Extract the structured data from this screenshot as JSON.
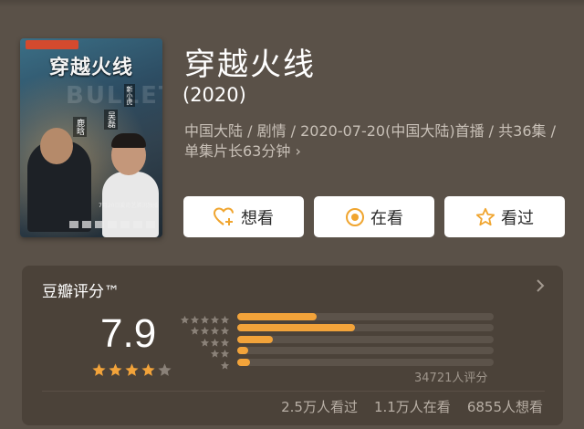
{
  "movie": {
    "title": "穿越火线",
    "year": "(2020)",
    "meta": "中国大陆 / 剧情 / 2020-07-20(中国大陆)首播 / 共36集 / 单集片长63分钟",
    "meta_chevron": "›"
  },
  "poster": {
    "title": "穿越火线",
    "tags": [
      "鹿晗",
      "吴磊",
      "新小虎"
    ],
    "date_text": "7月20日爱奇艺腾讯独播"
  },
  "actions": [
    {
      "label": "想看",
      "icon": "heart-plus-icon",
      "color": "#f0a52f"
    },
    {
      "label": "在看",
      "icon": "target-icon",
      "color": "#f0a52f"
    },
    {
      "label": "看过",
      "icon": "star-outline-icon",
      "color": "#f0a52f"
    }
  ],
  "rating": {
    "section_title": "豆瓣评分™",
    "score": "7.9",
    "main_stars": 4,
    "distribution": [
      {
        "stars": 5,
        "fraction": 0.31
      },
      {
        "stars": 4,
        "fraction": 0.46
      },
      {
        "stars": 3,
        "fraction": 0.14
      },
      {
        "stars": 2,
        "fraction": 0.04
      },
      {
        "stars": 1,
        "fraction": 0.05
      }
    ],
    "count_label": "34721人评分",
    "footer": [
      "2.5万人看过",
      "1.1万人在看",
      "6855人想看"
    ]
  },
  "colors": {
    "background": "#5a5148",
    "card": "#4b4239",
    "accent": "#f2a33a",
    "star_dim": "#8a8178"
  }
}
